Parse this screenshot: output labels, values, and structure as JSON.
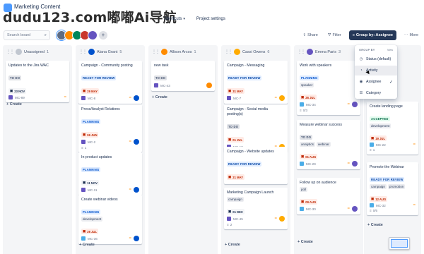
{
  "project": {
    "name": "Marketing Content"
  },
  "watermark": "dudu123.com嘟嘟Ai导航",
  "tabs": [
    {
      "label": "Shortcuts"
    },
    {
      "label": "Project settings"
    }
  ],
  "search": {
    "placeholder": "Search board"
  },
  "toolbar": {
    "share": "Share",
    "filter": "Filter",
    "group_by": "Group by: Assignee",
    "more": "More"
  },
  "colors": {
    "primary": "#253858",
    "accent": "#0052cc",
    "overdue": "#bf2600"
  },
  "columns": [
    {
      "name": "Unassigned",
      "count": "1"
    },
    {
      "name": "Alana Grant",
      "count": "5"
    },
    {
      "name": "Allison Arcos",
      "count": "1"
    },
    {
      "name": "Cassi Owens",
      "count": "6"
    },
    {
      "name": "Emma Paris",
      "count": "3"
    }
  ],
  "cards": {
    "c1": {
      "title": "Updates to the Jira WAC",
      "status": "TO DO",
      "date": "23 NOV",
      "key": "MC-89"
    },
    "c2": {
      "title": "Campaign - Community posting",
      "status": "READY FOR REVIEW",
      "date": "29 MAY",
      "key": "MC-8"
    },
    "c3": {
      "title": "Press/Analyst Relations",
      "status": "PLANNING",
      "date": "06 JUN",
      "key": "MC-2",
      "sub": "1"
    },
    "c4": {
      "title": "In-product updates",
      "status": "PLANNING",
      "date": "11 NOV",
      "key": "MC-11"
    },
    "c5": {
      "title": "Create webinar videos",
      "status": "PLANNING",
      "label": "development",
      "date": "26 JUL",
      "key": "MC-36"
    },
    "c6": {
      "title": "new task",
      "status": "TO DO",
      "key": "MC-43"
    },
    "c7": {
      "title": "Campaign - Messaging",
      "status": "READY FOR REVIEW",
      "date": "31 MAY",
      "key": "MC-7"
    },
    "c8": {
      "title": "Campaign - Social media posting(s)",
      "status": "TO DO",
      "date": "01 JUL",
      "key": "MC-10"
    },
    "c9": {
      "title": "Campaign - Website updates",
      "status": "READY FOR REVIEW",
      "date": "21 MAY",
      "key": "MC-9"
    },
    "c10": {
      "title": "Marketing Campaign Launch",
      "label": "campaign",
      "date": "01 DEC",
      "key": "MC-45",
      "sub": "2"
    },
    "c11": {
      "title": "Work with speakers",
      "status": "PLANNING",
      "label": "speaker",
      "date": "26 JUL",
      "key": "MC-34",
      "sub": "0/3"
    },
    "c12": {
      "title": "Measure webinar success",
      "status": "TO DO",
      "labels": [
        "analytics",
        "webinar"
      ],
      "date": "01 AUG",
      "key": "MC-29"
    },
    "c13": {
      "title": "Follow up on audience",
      "label": "poll",
      "date": "09 AUG",
      "key": "MC-30"
    },
    "c14": {
      "title": "Create landing page",
      "status": "ACCEPTED",
      "label": "development",
      "date": "19 JUL",
      "key": "MC-22",
      "sub": "1"
    },
    "c15": {
      "title": "Promote the Webinar",
      "status": "READY FOR REVIEW",
      "labels": [
        "campaign",
        "promotion"
      ],
      "date": "12 AUG",
      "key": "MC-32",
      "sub": "0/6"
    }
  },
  "create_label": "+ Create",
  "dropdown": {
    "header": "GROUP BY",
    "view": "View",
    "items": [
      {
        "label": "Status (default)",
        "icon": "status-icon"
      },
      {
        "label": "Activity",
        "icon": "activity-icon"
      },
      {
        "label": "Assignee",
        "icon": "assignee-icon"
      },
      {
        "label": "Category",
        "icon": "category-icon"
      }
    ]
  }
}
